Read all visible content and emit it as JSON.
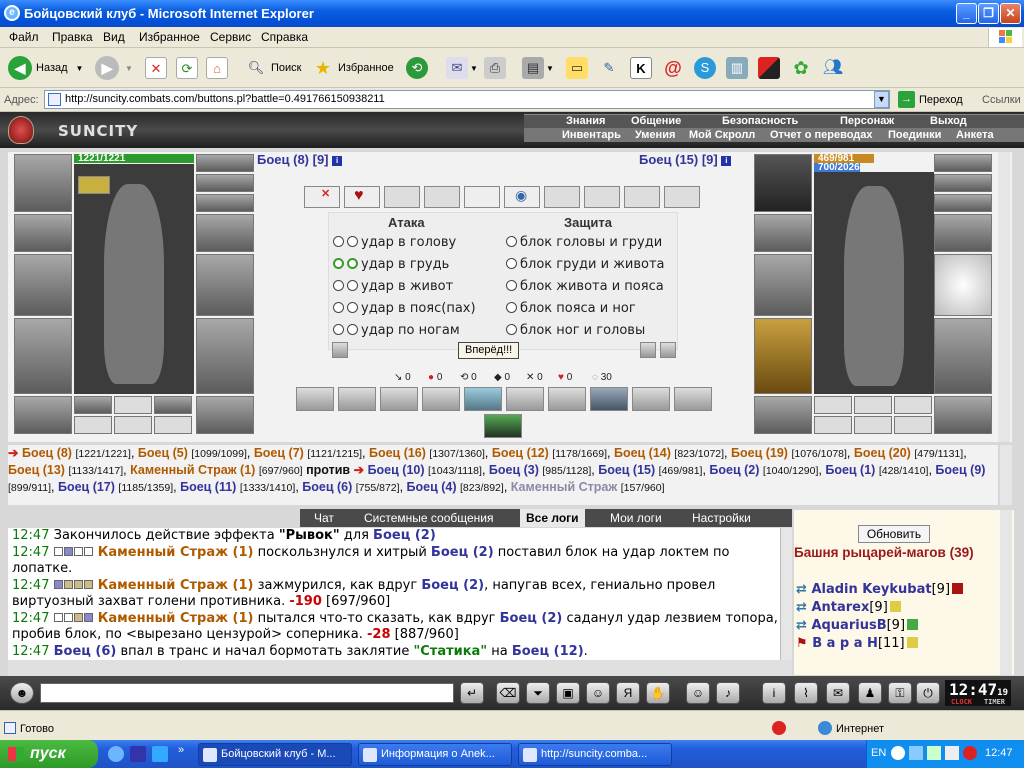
{
  "window": {
    "title": "Бойцовский клуб - Microsoft Internet Explorer"
  },
  "menu": [
    "Файл",
    "Правка",
    "Вид",
    "Избранное",
    "Сервис",
    "Справка"
  ],
  "toolbar": {
    "back": "Назад",
    "search": "Поиск",
    "favorites": "Избранное"
  },
  "address": {
    "label": "Адрес:",
    "url": "http://suncity.combats.com/buttons.pl?battle=0.491766150938211",
    "go": "Переход",
    "links": "Ссылки"
  },
  "game": {
    "logo": "SUNCITY",
    "nav_top": [
      "Знания",
      "Общение",
      "Безопасность",
      "Персонаж",
      "Выход"
    ],
    "nav_bottom": [
      "Инвентарь",
      "Умения",
      "Мой Скролл",
      "Отчет о переводах",
      "Поединки",
      "Анкета"
    ]
  },
  "battle": {
    "left": {
      "name": "Боец (8) [9]",
      "hp": "1221/1221"
    },
    "right": {
      "name": "Боец (15) [9]",
      "hp": "469/981",
      "mp": "700/2026"
    },
    "attack_title": "Атака",
    "defense_title": "Защита",
    "attacks": [
      "удар в голову",
      "удар в грудь",
      "удар в живот",
      "удар в пояс(пах)",
      "удар по ногам"
    ],
    "defenses": [
      "блок головы и груди",
      "блок груди и живота",
      "блок живота и пояса",
      "блок пояса и ног",
      "блок ног и головы"
    ],
    "forward": "Вперёд!!!",
    "stats": [
      "0",
      "0",
      "0",
      "0",
      "0",
      "0",
      "30"
    ]
  },
  "fighters_line": {
    "left_team": [
      {
        "n": "Боец (8)",
        "h": "[1221/1221]"
      },
      {
        "n": "Боец (5)",
        "h": "[1099/1099]"
      },
      {
        "n": "Боец (7)",
        "h": "[1121/1215]"
      },
      {
        "n": "Боец (16)",
        "h": "[1307/1360]"
      },
      {
        "n": "Боец (12)",
        "h": "[1178/1669]"
      },
      {
        "n": "Боец (14)",
        "h": "[823/1072]"
      },
      {
        "n": "Боец (19)",
        "h": "[1076/1078]"
      },
      {
        "n": "Боец (20)",
        "h": "[479/1131]"
      },
      {
        "n": "Боец (13)",
        "h": "[1133/1417]"
      },
      {
        "n": "Каменный Страж (1)",
        "h": "[697/960]"
      }
    ],
    "versus": "против",
    "right_team": [
      {
        "n": "Боец (10)",
        "h": "[1043/1118]"
      },
      {
        "n": "Боец (3)",
        "h": "[985/1128]"
      },
      {
        "n": "Боец (15)",
        "h": "[469/981]"
      },
      {
        "n": "Боец (2)",
        "h": "[1040/1290]"
      },
      {
        "n": "Боец (1)",
        "h": "[428/1410]"
      },
      {
        "n": "Боец (9)",
        "h": "[899/911]"
      },
      {
        "n": "Боец (17)",
        "h": "[1185/1359]"
      },
      {
        "n": "Боец (11)",
        "h": "[1333/1410]"
      },
      {
        "n": "Боец (6)",
        "h": "[755/872]"
      },
      {
        "n": "Боец (4)",
        "h": "[823/892]"
      },
      {
        "n": "Каменный Страж",
        "h": "[157/960]"
      }
    ]
  },
  "chat_tabs": [
    "Чат",
    "Системные сообщения",
    "Все логи",
    "Мои логи",
    "Настройки"
  ],
  "log": {
    "l1": {
      "t": "12:47",
      "a": "Закончилось действие эффекта ",
      "b": "\"Рывок\"",
      "c": " для ",
      "d": "Боец (2)"
    },
    "l2": {
      "t": "12:47",
      "a": "Каменный Страж (1)",
      "b": " поскользнулся и хитрый ",
      "c": "Боец (2)",
      "d": " поставил блок на удар локтем по лопатке."
    },
    "l3": {
      "t": "12:47",
      "a": "Каменный Страж (1)",
      "b": " зажмурился, как вдруг ",
      "c": "Боец (2)",
      "d": ", напугав всех, гениально провел виртуозный захват голени противника. ",
      "e": "-190",
      "f": " [697/960]"
    },
    "l4": {
      "t": "12:47",
      "a": "Каменный Страж (1)",
      "b": " пытался что-то сказать, как вдруг ",
      "c": "Боец (2)",
      "d": " саданул удар лезвием топора, пробив блок, по <вырезано цензурой> соперника. ",
      "e": "-28",
      "f": " [887/960]"
    },
    "l5": {
      "t": "12:47",
      "a": "Боец (6)",
      "b": " впал в транс и начал бормотать заклятие ",
      "c": "\"Статика\"",
      "d": " на ",
      "e": "Боец (12)",
      "f": "."
    }
  },
  "room": {
    "refresh": "Обновить",
    "name": "Башня рыцарей-магов (39)",
    "users": [
      {
        "n": "Aladin Keykubat",
        "l": "[9]"
      },
      {
        "n": "Antarex",
        "l": "[9]"
      },
      {
        "n": "AquariusB",
        "l": "[9]"
      },
      {
        "n": "В а р а Н",
        "l": "[11]"
      }
    ]
  },
  "clock": {
    "time": "12:47",
    "sec": "19",
    "clock_tag": "CLOCK",
    "timer_tag": "TIMER"
  },
  "status": {
    "text": "Готово",
    "zone": "Интернет"
  },
  "taskbar": {
    "start": "пуск",
    "tasks": [
      "Бойцовский клуб - M...",
      "Информация о Anek...",
      "http://suncity.comba..."
    ],
    "lang": "EN",
    "time": "12:47"
  },
  "colors": {
    "orange_fighter": "#b05a00",
    "blue_fighter": "#33349a",
    "timestamp": "#0a7a0a",
    "damage": "#cc0000",
    "room_title": "#9a1a1a"
  }
}
